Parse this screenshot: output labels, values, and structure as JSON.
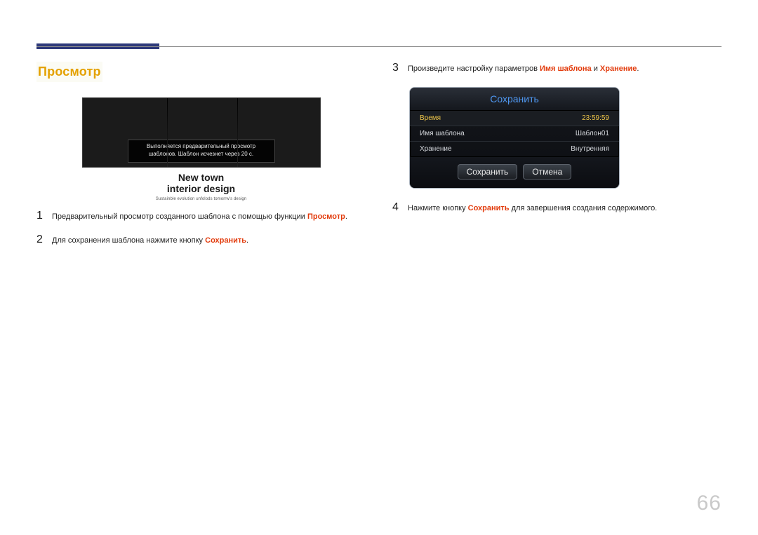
{
  "page_number": "66",
  "left": {
    "section_title": "Просмотр",
    "preview": {
      "overlay_line1": "Выполняется предварительный просмотр",
      "overlay_line2": "шаблонов. Шаблон исчезнет через 20 с.",
      "caption_line1": "New town",
      "caption_line2": "interior design",
      "caption_sub": "Sustainble evolution unfolods tomorrw's design"
    },
    "steps": [
      {
        "num": "1",
        "pre": "Предварительный просмотр созданного шаблона с помощью функции ",
        "hl": "Просмотр",
        "post": "."
      },
      {
        "num": "2",
        "pre": "Для сохранения шаблона нажмите кнопку ",
        "hl": "Сохранить",
        "post": "."
      }
    ]
  },
  "right": {
    "step3": {
      "num": "3",
      "pre": "Произведите настройку параметров ",
      "hl1": "Имя шаблона",
      "mid": " и ",
      "hl2": "Хранение",
      "post": "."
    },
    "dialog": {
      "title": "Сохранить",
      "rows": [
        {
          "label": "Время",
          "value": "23:59:59",
          "active": true
        },
        {
          "label": "Имя шаблона",
          "value": "Шаблон01",
          "active": false
        },
        {
          "label": "Хранение",
          "value": "Внутренняя",
          "active": false
        }
      ],
      "btn_save": "Сохранить",
      "btn_cancel": "Отмена"
    },
    "step4": {
      "num": "4",
      "pre": "Нажмите кнопку ",
      "hl": "Сохранить",
      "post": " для завершения создания содержимого."
    }
  }
}
